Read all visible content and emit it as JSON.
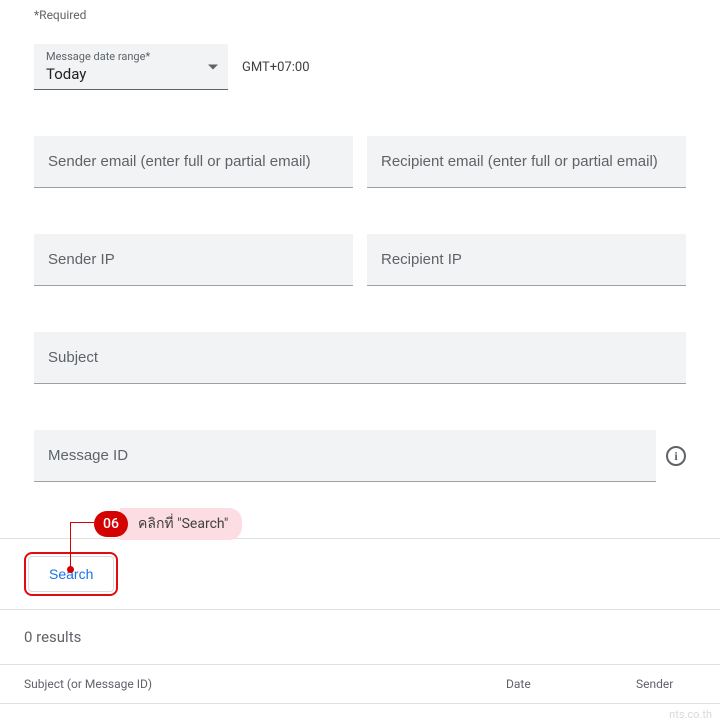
{
  "form": {
    "required_label": "*Required",
    "date_range": {
      "label": "Message date range*",
      "value": "Today"
    },
    "timezone": "GMT+07:00",
    "sender_email_ph": "Sender email (enter full or partial email)",
    "recipient_email_ph": "Recipient email (enter full or partial email)",
    "sender_ip_ph": "Sender IP",
    "recipient_ip_ph": "Recipient IP",
    "subject_ph": "Subject",
    "message_id_ph": "Message ID"
  },
  "callout": {
    "number": "06",
    "text": "คลิกที่ \"Search\""
  },
  "button": {
    "search": "Search"
  },
  "results": {
    "count_text": "0 results"
  },
  "table": {
    "col_subject": "Subject (or Message ID)",
    "col_date": "Date",
    "col_sender": "Sender"
  },
  "watermark": "nts.co.th"
}
